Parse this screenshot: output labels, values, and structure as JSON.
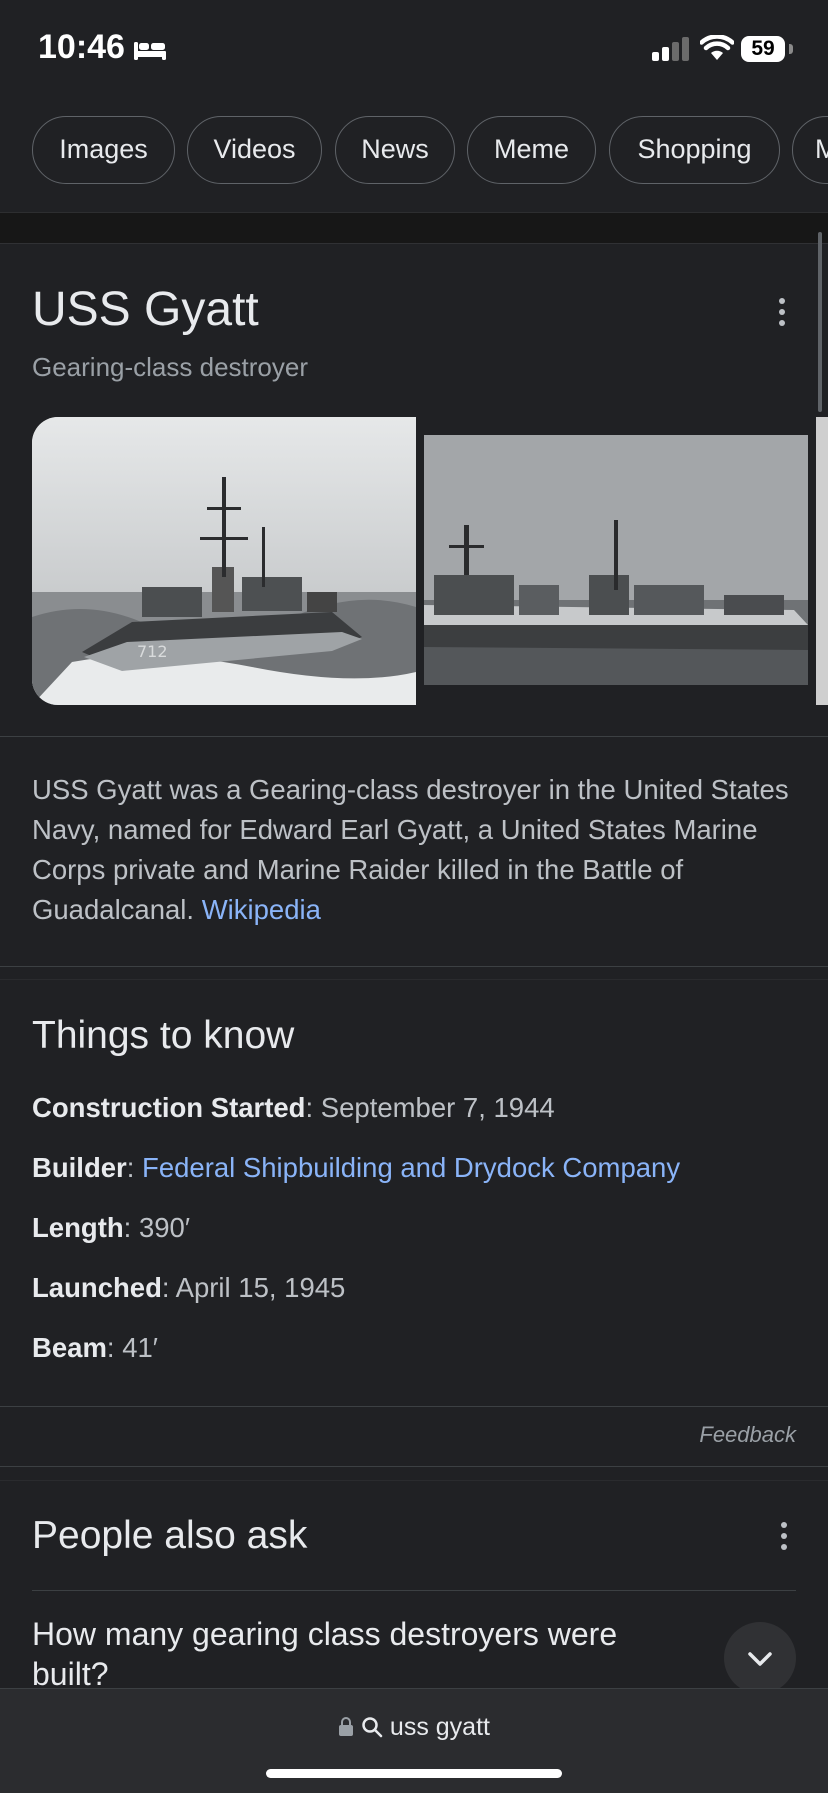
{
  "status": {
    "time": "10:46",
    "battery": "59"
  },
  "chips": [
    "Images",
    "Videos",
    "News",
    "Meme",
    "Shopping",
    "M"
  ],
  "entity": {
    "title": "USS Gyatt",
    "subtitle": "Gearing-class destroyer",
    "description": "USS Gyatt was a Gearing-class destroyer in the United States Navy, named for Edward Earl Gyatt, a United States Marine Corps private and Marine Raider killed in the Battle of Guadalcanal.",
    "source_link": "Wikipedia"
  },
  "things_to_know": {
    "title": "Things to know",
    "facts": [
      {
        "label": "Construction Started",
        "value": "September 7, 1944"
      },
      {
        "label": "Builder",
        "value": "Federal Shipbuilding and Drydock Company"
      },
      {
        "label": "Length",
        "value": "390′"
      },
      {
        "label": "Launched",
        "value": "April 15, 1945"
      },
      {
        "label": "Beam",
        "value": "41′"
      }
    ]
  },
  "feedback": "Feedback",
  "people_also_ask": {
    "title": "People also ask",
    "question": "How many gearing class destroyers were built?"
  },
  "address_bar": {
    "query": "uss gyatt"
  }
}
